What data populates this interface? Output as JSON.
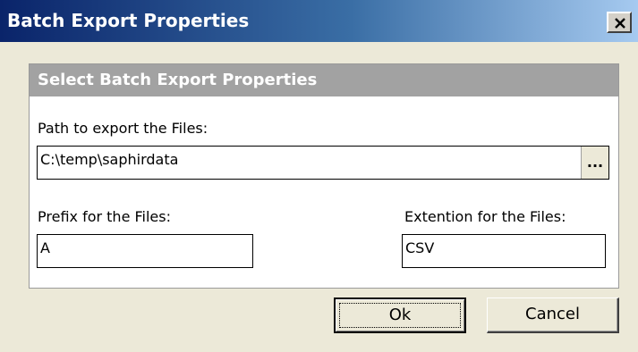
{
  "window": {
    "title": "Batch Export Properties"
  },
  "panel": {
    "header": "Select Batch Export Properties",
    "path_label": "Path to export the Files:",
    "path_value": "C:\\temp\\saphirdata",
    "browse_label": "...",
    "prefix_label": "Prefix for the Files:",
    "prefix_value": "A",
    "extension_label": "Extention for the Files:",
    "extension_value": "CSV"
  },
  "buttons": {
    "ok_label": "Ok",
    "cancel_label": "Cancel"
  },
  "icons": {
    "close": "close-icon"
  },
  "colors": {
    "titlebar_start": "#0a246a",
    "titlebar_end": "#a6caf0",
    "panel_header": "#a2a2a2",
    "window_bg": "#ece9d8"
  }
}
